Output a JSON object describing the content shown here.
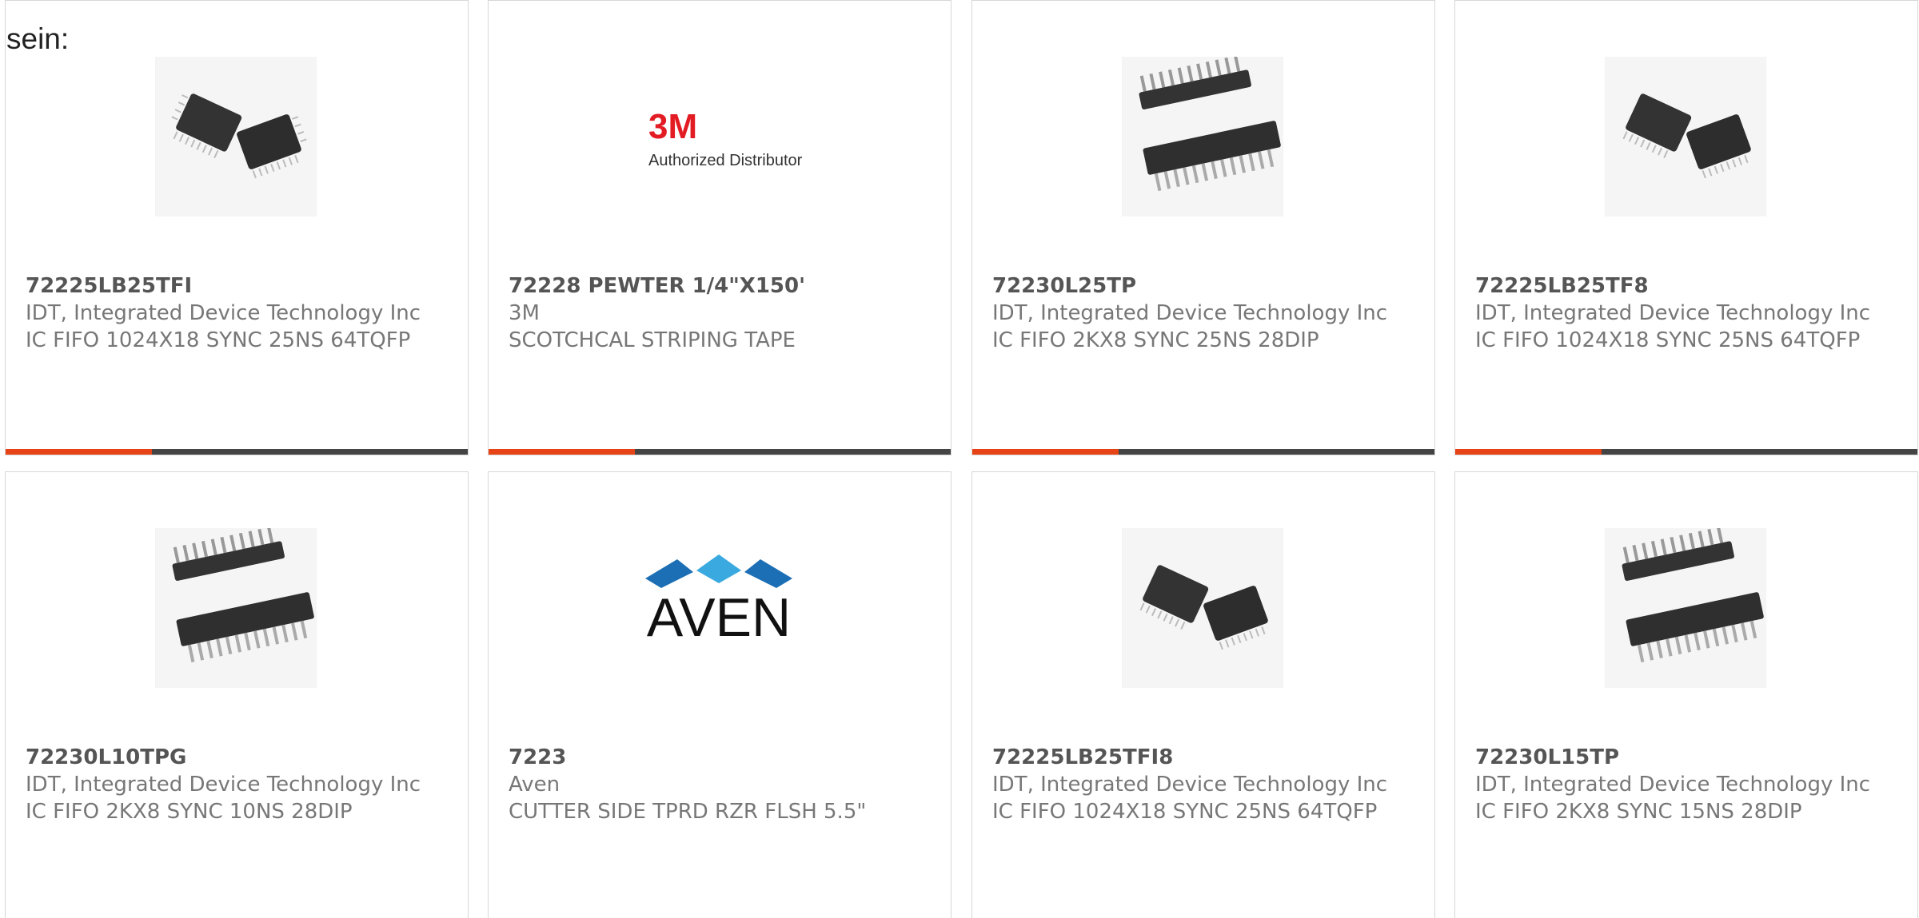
{
  "intro_text": "sein:",
  "products": [
    {
      "part": "72225LB25TFI",
      "manufacturer": "IDT, Integrated Device Technology Inc",
      "description": "IC FIFO 1024X18 SYNC 25NS 64TQFP",
      "image": "qfp-chip-image"
    },
    {
      "part": "72228 PEWTER 1/4\"X150'",
      "manufacturer": "3M",
      "description": "SCOTCHCAL STRIPING TAPE",
      "image": "3m-logo",
      "logo_brand": "3M",
      "logo_tagline": "Authorized Distributor"
    },
    {
      "part": "72230L25TP",
      "manufacturer": "IDT, Integrated Device Technology Inc",
      "description": "IC FIFO 2KX8 SYNC 25NS 28DIP",
      "image": "dip-chip-image"
    },
    {
      "part": "72225LB25TF8",
      "manufacturer": "IDT, Integrated Device Technology Inc",
      "description": "IC FIFO 1024X18 SYNC 25NS 64TQFP",
      "image": "qfp-chip-image"
    },
    {
      "part": "72230L10TPG",
      "manufacturer": "IDT, Integrated Device Technology Inc",
      "description": "IC FIFO 2KX8 SYNC 10NS 28DIP",
      "image": "dip-chip-image"
    },
    {
      "part": "7223",
      "manufacturer": "Aven",
      "description": "CUTTER SIDE TPRD RZR FLSH 5.5\"",
      "image": "aven-logo",
      "logo_brand": "AVEN"
    },
    {
      "part": "72225LB25TFI8",
      "manufacturer": "IDT, Integrated Device Technology Inc",
      "description": "IC FIFO 1024X18 SYNC 25NS 64TQFP",
      "image": "qfp-chip-image"
    },
    {
      "part": "72230L15TP",
      "manufacturer": "IDT, Integrated Device Technology Inc",
      "description": "IC FIFO 2KX8 SYNC 15NS 28DIP",
      "image": "dip-chip-image"
    }
  ],
  "colors": {
    "accent": "#e64416",
    "bar": "#444444",
    "border": "#d7d7d7",
    "text": "#777777",
    "part_text": "#555555"
  }
}
